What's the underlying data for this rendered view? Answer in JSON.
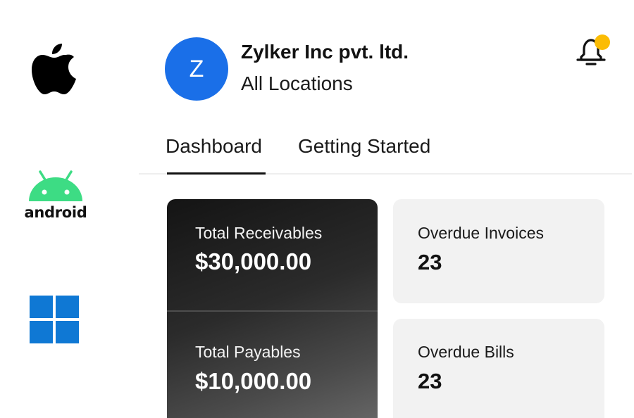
{
  "platforms": {
    "apple": "apple-icon",
    "android": {
      "icon": "android-icon",
      "label": "android"
    },
    "windows": "windows-icon"
  },
  "header": {
    "avatar_initial": "Z",
    "org_name": "Zylker Inc pvt. ltd.",
    "location": "All Locations",
    "notification_icon": "bell-icon"
  },
  "tabs": [
    {
      "label": "Dashboard",
      "active": true
    },
    {
      "label": "Getting Started",
      "active": false
    }
  ],
  "cards": {
    "total_receivables": {
      "label": "Total Receivables",
      "value": "$30,000.00"
    },
    "total_payables": {
      "label": "Total Payables",
      "value": "$10,000.00"
    },
    "overdue_invoices": {
      "label": "Overdue Invoices",
      "value": "23"
    },
    "overdue_bills": {
      "label": "Overdue Bills",
      "value": "23"
    }
  },
  "colors": {
    "avatar": "#1a6fe8",
    "android_green": "#3ddc84",
    "windows_blue": "#0f78d4",
    "notification_dot": "#fbbc04",
    "dark_card": "#1f1f1f",
    "light_card": "#f2f2f2"
  }
}
